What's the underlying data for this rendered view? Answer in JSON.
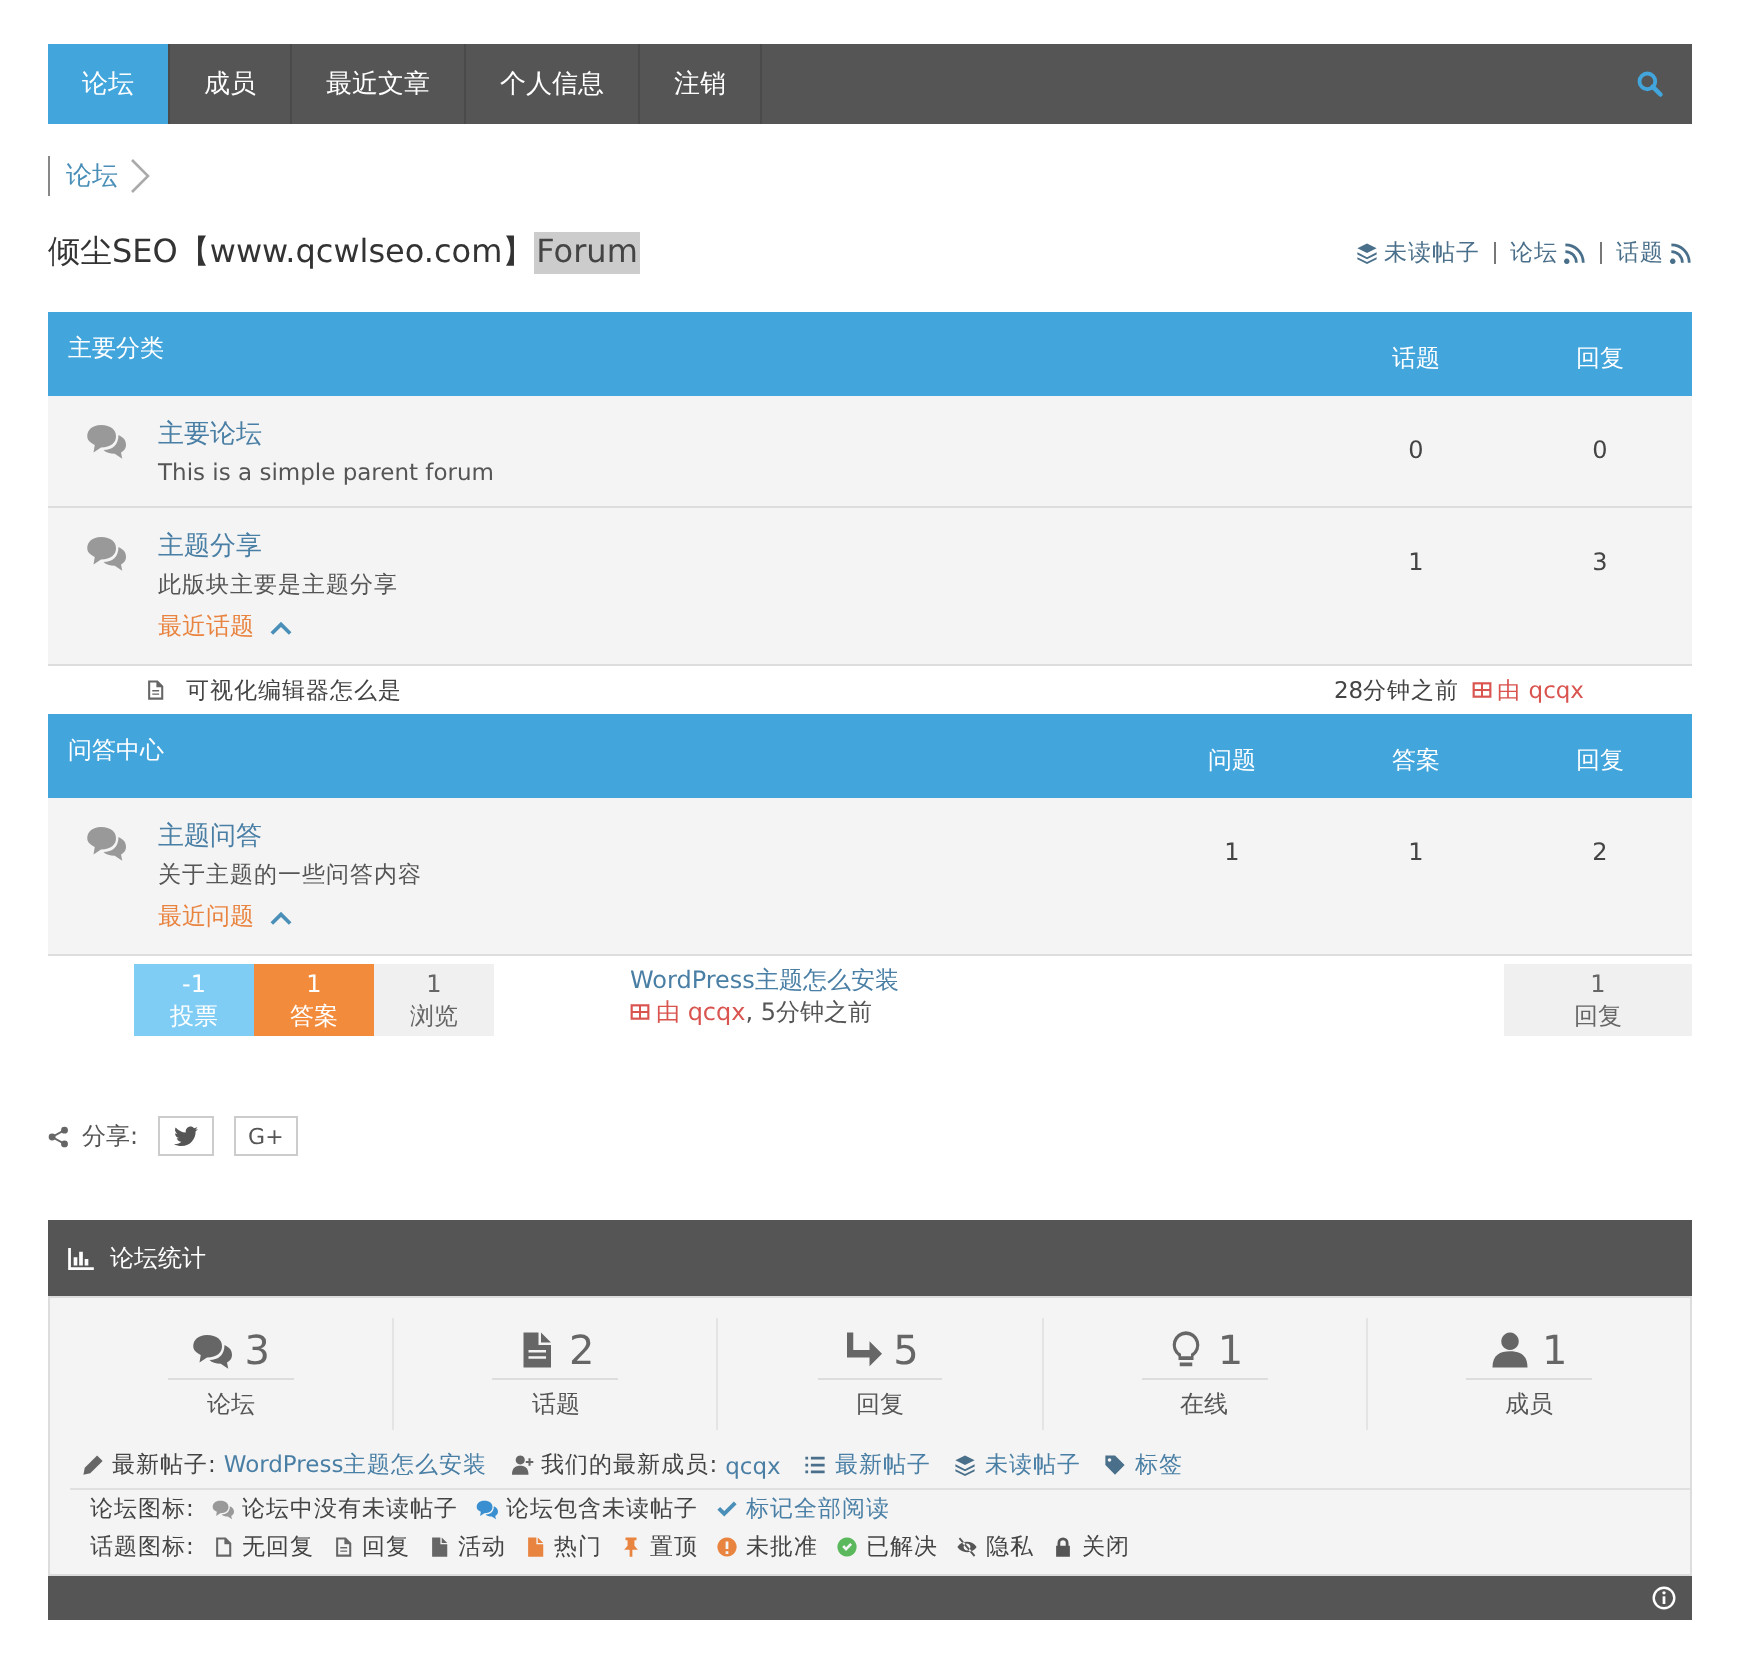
{
  "nav": {
    "items": [
      {
        "label": "论坛",
        "selected": true
      },
      {
        "label": "成员",
        "selected": false
      },
      {
        "label": "最近文章",
        "selected": false
      },
      {
        "label": "个人信息",
        "selected": false
      },
      {
        "label": "注销",
        "selected": false
      }
    ]
  },
  "breadcrumb": [
    "论坛"
  ],
  "title": {
    "main": "倾尘SEO【www.qcwlseo.com】",
    "highlight": "Forum"
  },
  "header_links": [
    {
      "kind": "layers",
      "label": "未读帖子"
    },
    {
      "kind": "rss",
      "label": "论坛"
    },
    {
      "kind": "rss",
      "label": "话题"
    }
  ],
  "categories": [
    {
      "title": "主要分类",
      "columns": [
        "话题",
        "回复"
      ],
      "forums": [
        {
          "name": "主要论坛",
          "description": "This is a simple parent forum",
          "counts": [
            "0",
            "0"
          ]
        },
        {
          "name": "主题分享",
          "description": "此版块主要是主题分享",
          "counts": [
            "1",
            "3"
          ],
          "recent_label": "最近话题",
          "expanded": true
        }
      ],
      "recent_topics": [
        {
          "title": "可视化编辑器怎么是",
          "time": "28分钟之前",
          "author": "由 qcqx"
        }
      ]
    },
    {
      "title": "问答中心",
      "columns": [
        "问题",
        "答案",
        "回复"
      ],
      "forums": [
        {
          "name": "主题问答",
          "description": "关于主题的一些问答内容",
          "counts": [
            "1",
            "1",
            "2"
          ],
          "recent_label": "最近问题",
          "expanded": true
        }
      ],
      "questions": [
        {
          "votes": "-1",
          "votes_label": "投票",
          "answers": "1",
          "answers_label": "答案",
          "views": "1",
          "views_label": "浏览",
          "title": "WordPress主题怎么安装",
          "author": "由 qcqx",
          "time": ", 5分钟之前",
          "replies": "1",
          "replies_label": "回复"
        }
      ]
    }
  ],
  "share": {
    "label": "分享:",
    "buttons": [
      {
        "kind": "twitter"
      },
      {
        "kind": "text",
        "label": "G+"
      }
    ]
  },
  "stats": {
    "title": "论坛统计",
    "items": [
      {
        "kind": "forums",
        "value": "3",
        "label": "论坛"
      },
      {
        "kind": "topics",
        "value": "2",
        "label": "话题"
      },
      {
        "kind": "replies",
        "value": "5",
        "label": "回复"
      },
      {
        "kind": "online",
        "value": "1",
        "label": "在线"
      },
      {
        "kind": "members",
        "value": "1",
        "label": "成员"
      }
    ],
    "info": [
      {
        "kind": "pencil",
        "label": "最新帖子:",
        "link": "WordPress主题怎么安装"
      },
      {
        "kind": "user-plus",
        "label": "我们的最新成员:",
        "link": "qcqx"
      },
      {
        "kind": "list",
        "link": "最新帖子"
      },
      {
        "kind": "layers",
        "link": "未读帖子"
      },
      {
        "kind": "tag",
        "link": "标签"
      }
    ],
    "forum_legend": {
      "label": "论坛图标:",
      "items": [
        {
          "kind": "read",
          "label": "论坛中没有未读帖子"
        },
        {
          "kind": "unread",
          "label": "论坛包含未读帖子"
        },
        {
          "kind": "check",
          "link": "标记全部阅读"
        }
      ]
    },
    "topic_legend": {
      "label": "话题图标:",
      "items": [
        {
          "kind": "file",
          "label": "无回复"
        },
        {
          "kind": "file-text",
          "label": "回复"
        },
        {
          "kind": "file-solid",
          "label": "活动"
        },
        {
          "kind": "hot",
          "label": "热门"
        },
        {
          "kind": "pin",
          "label": "置顶"
        },
        {
          "kind": "alert",
          "label": "未批准"
        },
        {
          "kind": "solved",
          "label": "已解决"
        },
        {
          "kind": "private",
          "label": "隐私"
        },
        {
          "kind": "lock",
          "label": "关闭"
        }
      ]
    }
  }
}
